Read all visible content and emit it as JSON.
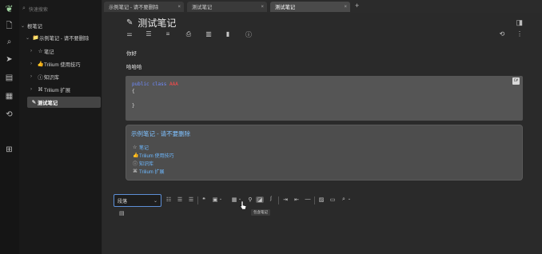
{
  "search": {
    "placeholder": "快速搜索"
  },
  "tree": {
    "root": "根笔记",
    "items": [
      {
        "label": "示例笔记 - 请不要删除",
        "icon": "📁"
      },
      {
        "label": "笔记",
        "icon": "☆"
      },
      {
        "label": "Trilium 使用技巧",
        "icon": "👍"
      },
      {
        "label": "知识库",
        "icon": "ⓘ"
      },
      {
        "label": "Trilium 扩展",
        "icon": "⌘"
      },
      {
        "label": "测试笔记",
        "icon": "✎"
      }
    ]
  },
  "tabs": [
    {
      "label": "示例笔记 - 请不要删除"
    },
    {
      "label": "测试笔记"
    },
    {
      "label": "测试笔记"
    }
  ],
  "note": {
    "title": "测试笔记",
    "paragraph1": "你好",
    "paragraph2": "哈哈哈",
    "code": {
      "lang": "C#",
      "line1_kw1": "public",
      "line1_kw2": "class",
      "line1_cls": "AAA",
      "line2": "{",
      "line3": "",
      "line4": "}"
    },
    "included": {
      "title": "示例笔记 - 请不要删除",
      "items": [
        {
          "icon": "☆",
          "label": "笔记"
        },
        {
          "icon": "👍",
          "label": "Trilium 使用技巧"
        },
        {
          "icon": "ⓘ",
          "label": "知识库"
        },
        {
          "icon": "⌘",
          "label": "Trilium 扩展"
        }
      ]
    }
  },
  "toolbar": {
    "heading_select": "段落",
    "tooltip": "包含笔记"
  },
  "icons": {
    "launcher": [
      "file-icon",
      "search-icon",
      "send-icon",
      "map-icon",
      "calendar-icon",
      "history-icon",
      "save-icon"
    ]
  }
}
